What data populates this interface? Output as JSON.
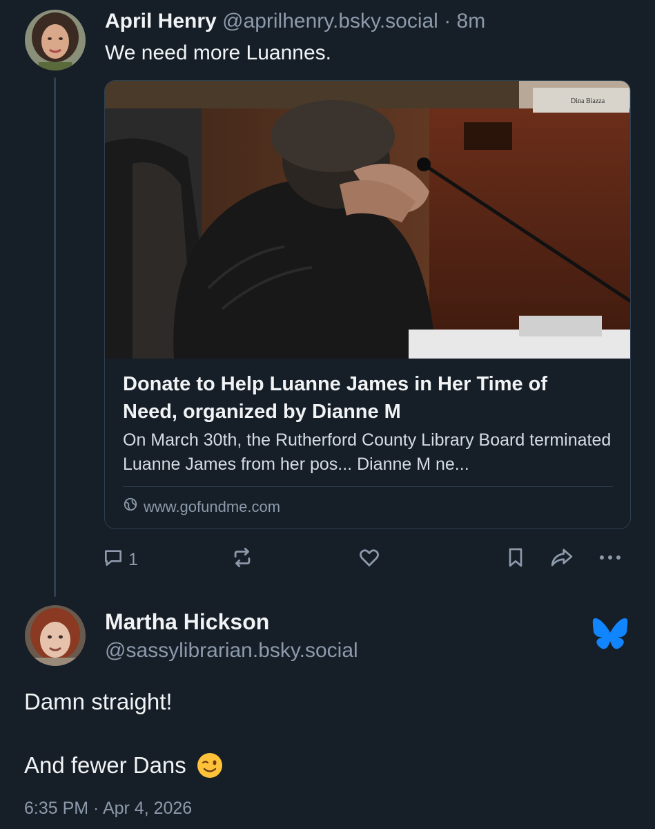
{
  "colors": {
    "background": "#161e27",
    "text_primary": "#f1f3f5",
    "text_secondary": "#8c9aab",
    "border": "#2e4052",
    "bluesky_blue": "#1185fe"
  },
  "post": {
    "author_name": "April Henry",
    "author_handle": "@aprilhenry.bsky.social",
    "separator": "·",
    "time": "8m",
    "text": "We need more Luannes.",
    "embed": {
      "title": "Donate to Help Luanne James in Her Time of Need, organized by Dianne M",
      "description": "On March 30th, the Rutherford County Library Board terminated Luanne James from her pos... Dianne M ne...",
      "domain": "www.gofundme.com",
      "domain_icon": "globe-icon",
      "image_alt": "Woman in black sweater covering face with hands at a board meeting desk with microphone",
      "nameplate_text": "Dina Biazza"
    },
    "actions": {
      "reply_icon": "comment-icon",
      "reply_count": "1",
      "repost_icon": "repost-icon",
      "like_icon": "heart-icon",
      "bookmark_icon": "bookmark-icon",
      "share_icon": "share-icon",
      "more_icon": "more-dots-icon"
    }
  },
  "reply": {
    "author_name": "Martha Hickson",
    "author_handle": "@sassylibrarian.bsky.social",
    "badge_icon": "bluesky-butterfly-icon",
    "text_line_1": "Damn straight!",
    "text_line_2": "And fewer Dans",
    "emoji": "winking-face-emoji",
    "timestamp": "6:35 PM · Apr 4, 2026"
  }
}
